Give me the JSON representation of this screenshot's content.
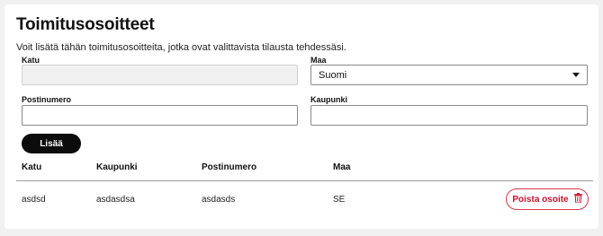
{
  "page": {
    "title": "Toimitusosoitteet",
    "description": "Voit lisätä tähän toimitusosoitteita, jotka ovat valittavista tilausta tehdessäsi."
  },
  "form": {
    "street_label": "Katu",
    "street_value": "",
    "country_label": "Maa",
    "country_value": "Suomi",
    "postal_label": "Postinumero",
    "postal_value": "",
    "city_label": "Kaupunki",
    "city_value": "",
    "add_label": "Lisää"
  },
  "table": {
    "headers": [
      "Katu",
      "Kaupunki",
      "Postinumero",
      "Maa"
    ],
    "rows": [
      {
        "street": "asdsd",
        "city": "asdasdsa",
        "postal": "asdasds",
        "country": "SE",
        "delete_label": "Poista osoite"
      }
    ]
  },
  "colors": {
    "accent": "#c8102e",
    "button_dark": "#0c0c0c"
  },
  "icons": {
    "delete": "trash-icon",
    "dropdown": "chevron-down-icon"
  }
}
